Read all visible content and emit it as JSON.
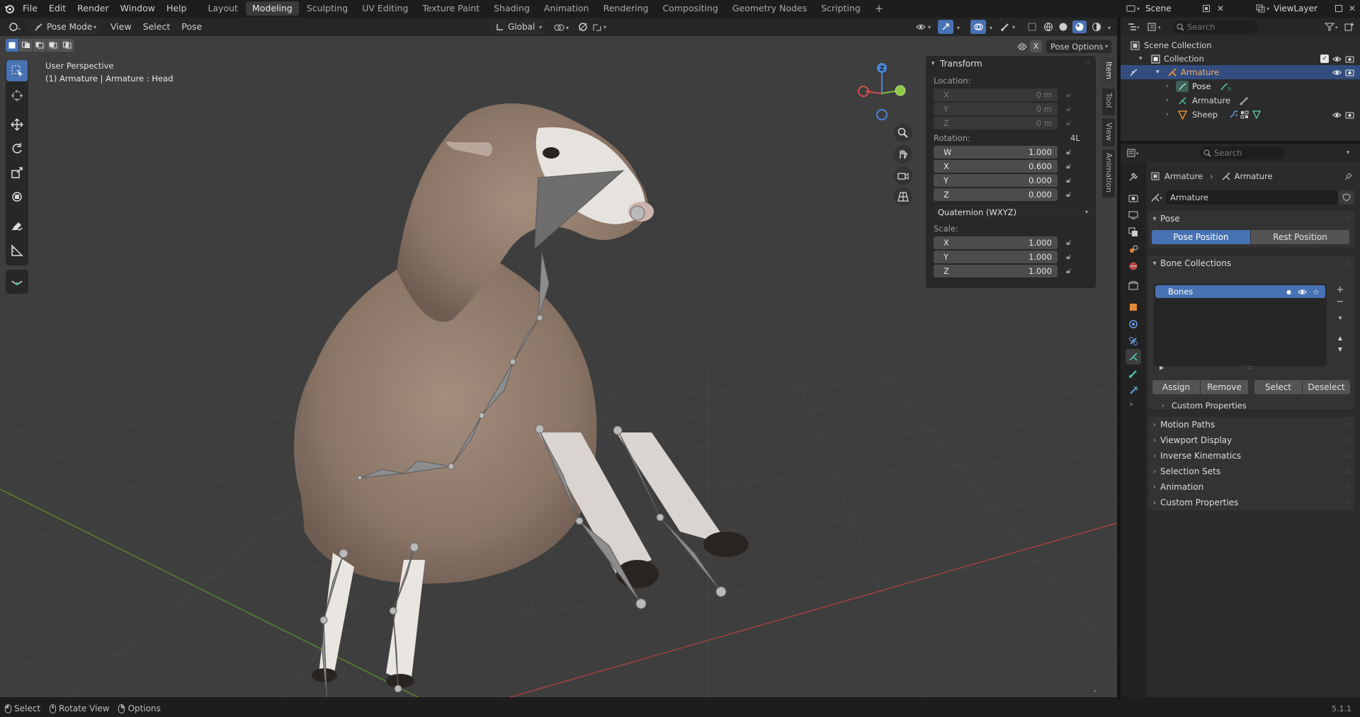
{
  "menu": {
    "file": "File",
    "edit": "Edit",
    "render": "Render",
    "window": "Window",
    "help": "Help"
  },
  "workspaces": [
    {
      "label": "Layout",
      "active": false
    },
    {
      "label": "Modeling",
      "active": true
    },
    {
      "label": "Sculpting",
      "active": false
    },
    {
      "label": "UV Editing",
      "active": false
    },
    {
      "label": "Texture Paint",
      "active": false
    },
    {
      "label": "Shading",
      "active": false
    },
    {
      "label": "Animation",
      "active": false
    },
    {
      "label": "Rendering",
      "active": false
    },
    {
      "label": "Compositing",
      "active": false
    },
    {
      "label": "Geometry Nodes",
      "active": false
    },
    {
      "label": "Scripting",
      "active": false
    }
  ],
  "add_workspace": "+",
  "scene": {
    "name": "Scene",
    "view_layer": "ViewLayer"
  },
  "viewport_header": {
    "mode": "Pose Mode",
    "view": "View",
    "select": "Select",
    "pose": "Pose",
    "orientation": "Global",
    "pose_options": "Pose Options",
    "x_mirror": "X"
  },
  "viewport": {
    "perspective": "User Perspective",
    "active": "(1) Armature | Armature : Head"
  },
  "gizmo": {
    "z": "Z"
  },
  "npanel": {
    "title": "Transform",
    "location_label": "Location:",
    "location": [
      {
        "axis": "X",
        "value": "0 m"
      },
      {
        "axis": "Y",
        "value": "0 m"
      },
      {
        "axis": "Z",
        "value": "0 m"
      }
    ],
    "rotation_label": "Rotation:",
    "rotation_mode_tag": "4L",
    "rotation": [
      {
        "axis": "W",
        "value": "1.000"
      },
      {
        "axis": "X",
        "value": "0.600"
      },
      {
        "axis": "Y",
        "value": "0.000"
      },
      {
        "axis": "Z",
        "value": "0.000"
      }
    ],
    "rotation_mode": "Quaternion (WXYZ)",
    "scale_label": "Scale:",
    "scale": [
      {
        "axis": "X",
        "value": "1.000"
      },
      {
        "axis": "Y",
        "value": "1.000"
      },
      {
        "axis": "Z",
        "value": "1.000"
      }
    ],
    "tabs": [
      "Item",
      "Tool",
      "View",
      "Animation"
    ]
  },
  "outliner": {
    "search_placeholder": "Search",
    "scene_collection": "Scene Collection",
    "collection": "Collection",
    "armature": "Armature",
    "pose": "Pose",
    "armature_data": "Armature",
    "sheep": "Sheep"
  },
  "properties": {
    "search_placeholder": "Search",
    "breadcrumb_object": "Armature",
    "breadcrumb_data": "Armature",
    "datablock": "Armature",
    "pose_panel": "Pose",
    "pose_position": "Pose Position",
    "rest_position": "Rest Position",
    "bone_collections": "Bone Collections",
    "bone_collection_item": "Bones",
    "assign": "Assign",
    "remove": "Remove",
    "select": "Select",
    "deselect": "Deselect",
    "custom_properties_inner": "Custom Properties",
    "panels": [
      "Motion Paths",
      "Viewport Display",
      "Inverse Kinematics",
      "Selection Sets",
      "Animation",
      "Custom Properties"
    ]
  },
  "status": {
    "select": "Select",
    "rotate_view": "Rotate View",
    "options": "Options",
    "version": "5.1.1"
  },
  "colors": {
    "accent": "#4772b3",
    "active_tab": "#3a3a3a",
    "header": "#262626",
    "viewport_bg": "#3e3e3e",
    "panel": "#2b2b2b",
    "armature_orange": "#e08a35",
    "bone_green": "#4fc1a5"
  }
}
